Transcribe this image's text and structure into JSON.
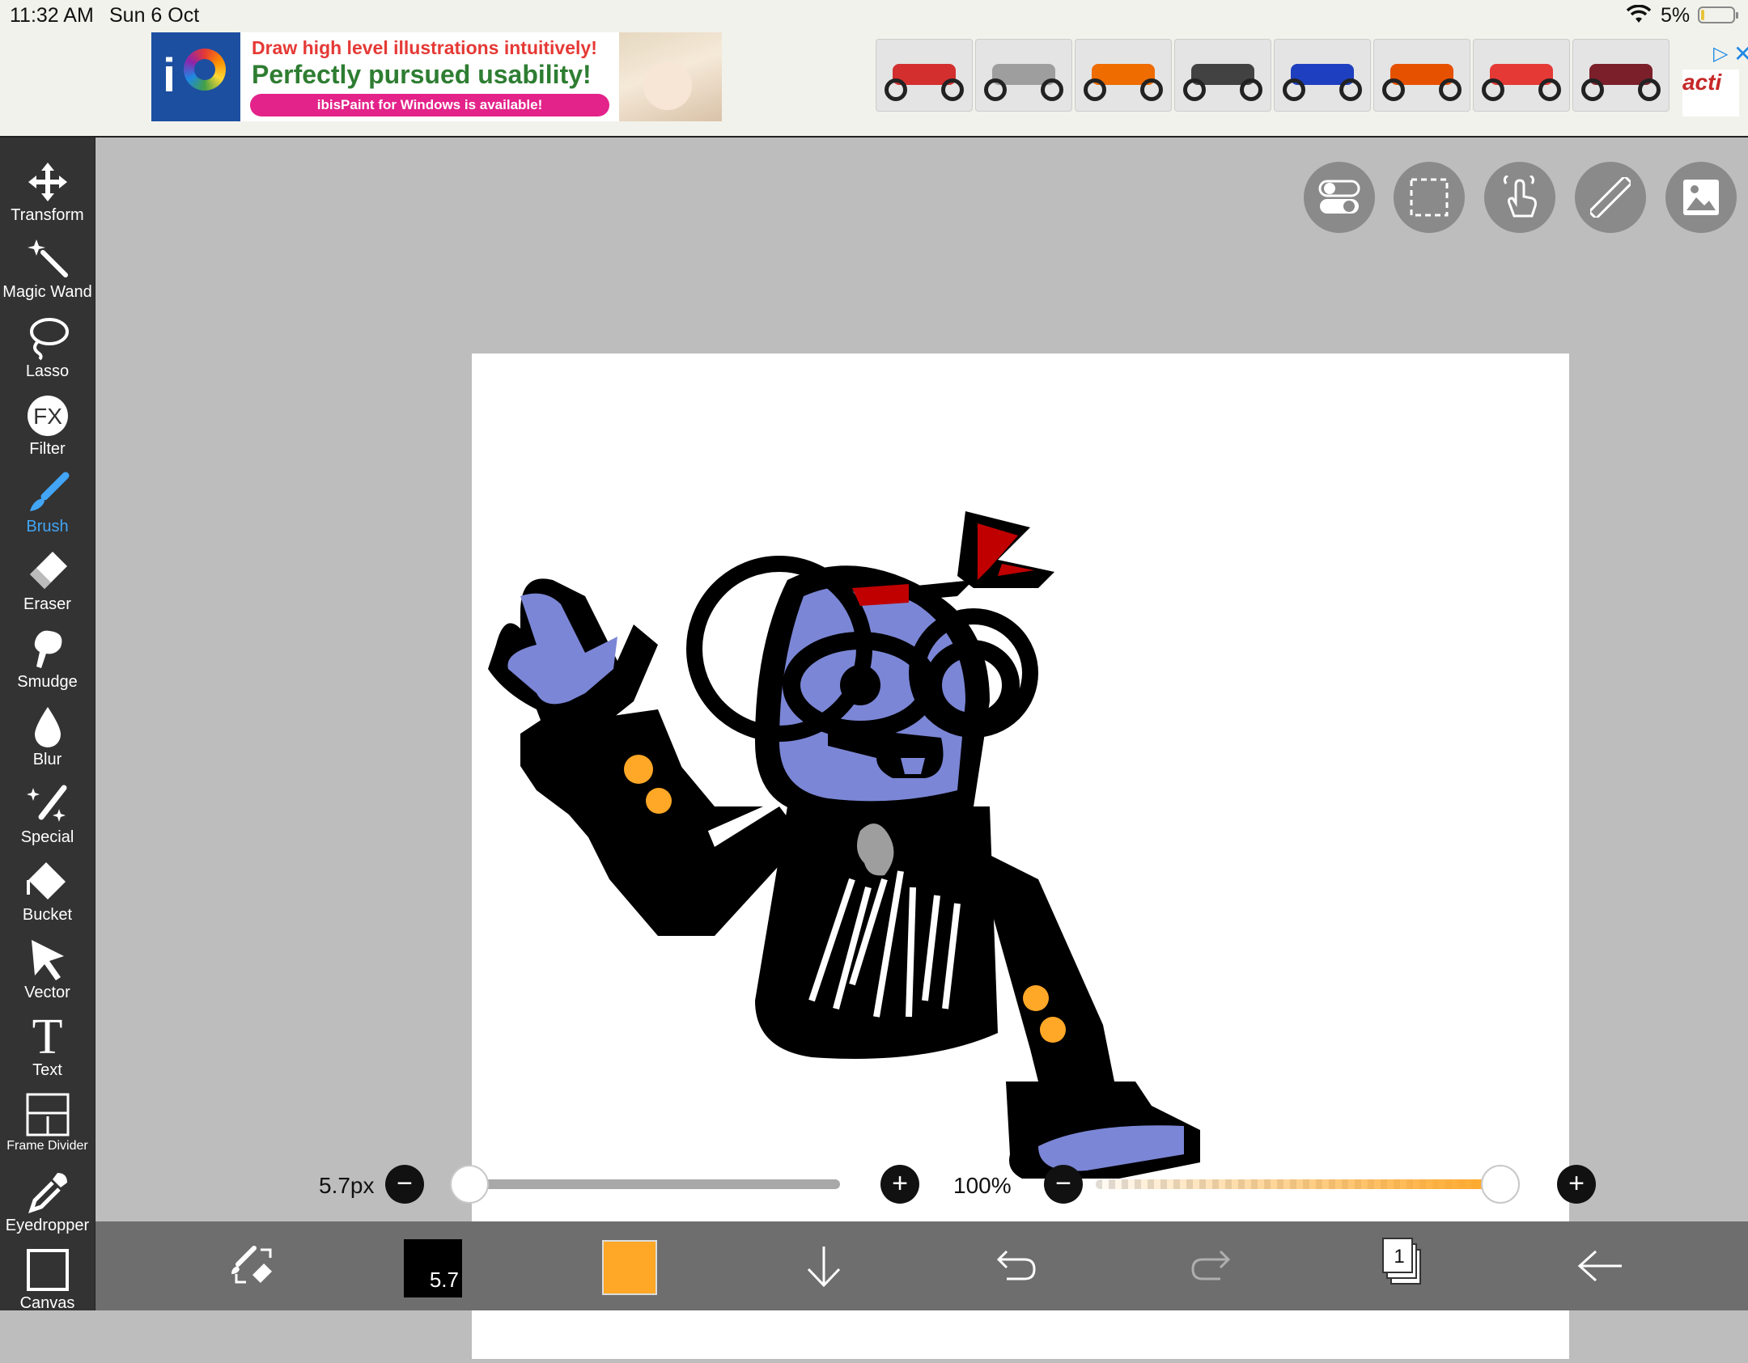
{
  "status_bar": {
    "time": "11:32 AM",
    "date": "Sun 6 Oct",
    "battery": "5%"
  },
  "ad": {
    "line1": "Draw high level illustrations intuitively!",
    "line2": "Perfectly pursued usability!",
    "pill": "ibisPaint for Windows is available!",
    "brand": "acti"
  },
  "tools": [
    {
      "label": "Transform",
      "icon": "transform-icon"
    },
    {
      "label": "Magic Wand",
      "icon": "magic-wand-icon"
    },
    {
      "label": "Lasso",
      "icon": "lasso-icon"
    },
    {
      "label": "Filter",
      "icon": "fx-icon"
    },
    {
      "label": "Brush",
      "icon": "brush-icon"
    },
    {
      "label": "Eraser",
      "icon": "eraser-icon"
    },
    {
      "label": "Smudge",
      "icon": "smudge-icon"
    },
    {
      "label": "Blur",
      "icon": "blur-icon"
    },
    {
      "label": "Special",
      "icon": "special-icon"
    },
    {
      "label": "Bucket",
      "icon": "bucket-icon"
    },
    {
      "label": "Vector",
      "icon": "vector-icon"
    },
    {
      "label": "Text",
      "icon": "text-icon"
    },
    {
      "label": "Frame Divider",
      "icon": "frame-divider-icon"
    },
    {
      "label": "Eyedropper",
      "icon": "eyedropper-icon"
    },
    {
      "label": "Canvas",
      "icon": "canvas-icon"
    }
  ],
  "active_tool": "Brush",
  "brush": {
    "size_label": "5.7px",
    "size_value_fraction": 0.0,
    "opacity_label": "100%",
    "opacity_fraction": 1.0
  },
  "bottom_bar": {
    "brush_size": "5.7",
    "layer_count": "1"
  },
  "colors": {
    "accent": "#42a5f5",
    "current_color": "#ffa726",
    "toolbar_bg": "#333333"
  }
}
